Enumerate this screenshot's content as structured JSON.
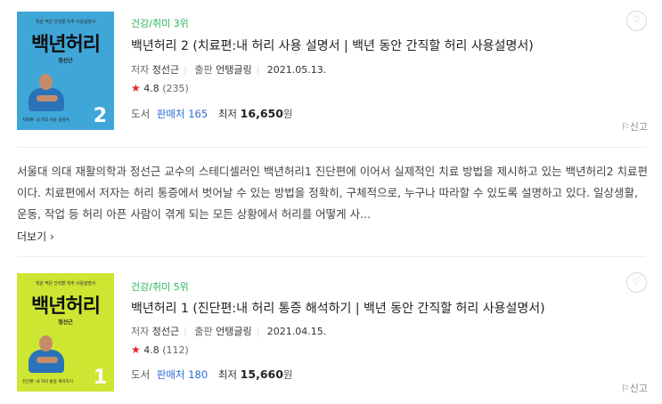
{
  "books": [
    {
      "category": "건강/취미 3위",
      "title": "백년허리 2 (치료편:내 허리 사용 설명서 | 백년 동안 간직할 허리 사용설명서)",
      "author_label": "저자",
      "author": "정선근",
      "publisher_label": "출판",
      "publisher": "언탱글링",
      "date": "2021.05.13.",
      "rating": "4.8",
      "rating_count": "(235)",
      "type_label": "도서",
      "sellers": "판매처 165",
      "lowest_label": "최저",
      "price": "16,650",
      "price_unit": "원",
      "report": "신고",
      "cover": {
        "tag": "척삼 찍은 간직할 척추 사용설명서",
        "title": "백년허리",
        "author": "정선근",
        "subtitle": "치료편: 내 허리 사용 설명서",
        "number": "2",
        "color": "#3fa6d8"
      }
    },
    {
      "category": "건강/취미 5위",
      "title": "백년허리 1 (진단편:내 허리 통증 해석하기 | 백년 동안 간직할 허리 사용설명서)",
      "author_label": "저자",
      "author": "정선근",
      "publisher_label": "출판",
      "publisher": "언탱글링",
      "date": "2021.04.15.",
      "rating": "4.8",
      "rating_count": "(112)",
      "type_label": "도서",
      "sellers": "판매처 180",
      "lowest_label": "최저",
      "price": "15,660",
      "price_unit": "원",
      "report": "신고",
      "cover": {
        "tag": "척삼 찍은 간직할 척추 사용설명서",
        "title": "백년허리",
        "author": "정선근",
        "subtitle": "진단편: 내 허리 통증 해석하기",
        "number": "1",
        "color": "#cde632"
      }
    }
  ],
  "description": "서울대 의대 재활의학과 정선근 교수의 스테디셀러인 백년허리1 진단편에 이어서 실제적인 치료 방법을 제시하고 있는 백년허리2 치료편이다. 치료편에서 저자는 허리 통증에서 벗어날 수 있는 방법을 정확히, 구체적으로, 누구나 따라할 수 있도록 설명하고 있다. 일상생활, 운동, 작업 등 허리 아픈 사람이 겪게 되는 모든 상황에서 허리를 어떻게 사...",
  "more_label": "더보기",
  "icons": {
    "heart": "heart-icon",
    "star": "star-icon",
    "report": "report-icon",
    "chevron": "chevron-right-icon"
  },
  "colors": {
    "category": "#2bb45e",
    "star": "#e3242b",
    "link": "#2b6bd6"
  }
}
